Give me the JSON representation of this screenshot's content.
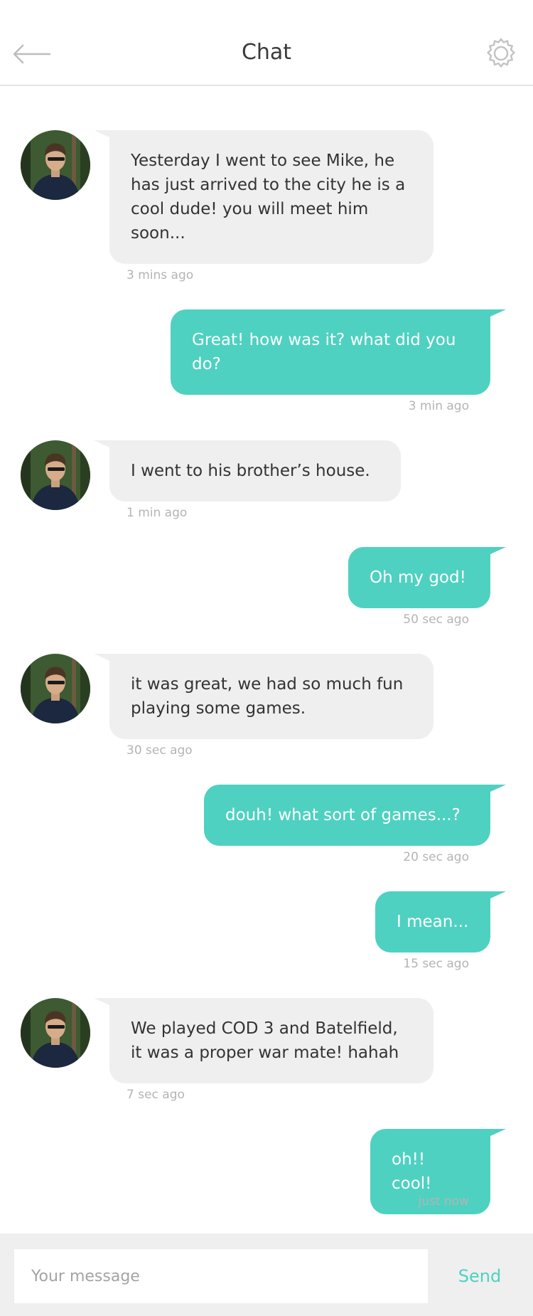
{
  "header": {
    "title": "Chat",
    "back_icon": "arrow-left-icon",
    "settings_icon": "gear-icon"
  },
  "colors": {
    "accent": "#4ed1c1",
    "incoming_bubble": "#efefef",
    "timestamp": "#b4b4b4"
  },
  "messages": [
    {
      "direction": "incoming",
      "text": "Yesterday I went to see Mike, he has just arrived to the city he is a cool dude! you will meet him soon...",
      "time": "3 mins ago"
    },
    {
      "direction": "outgoing",
      "text": "Great! how was it? what did you do?",
      "time": "3 min ago"
    },
    {
      "direction": "incoming",
      "text": "I went to his brother’s house.",
      "time": "1 min ago"
    },
    {
      "direction": "outgoing",
      "text": "Oh my god!",
      "time": "50 sec ago"
    },
    {
      "direction": "incoming",
      "text": "it was great, we had so much fun playing some games.",
      "time": "30 sec ago"
    },
    {
      "direction": "outgoing",
      "text": "douh! what sort of games...?",
      "time": "20 sec ago"
    },
    {
      "direction": "outgoing",
      "text": "I mean...",
      "time": "15 sec ago"
    },
    {
      "direction": "incoming",
      "text": "We played COD 3 and Batelfield, it was a proper war mate! hahah",
      "time": "7 sec ago"
    },
    {
      "direction": "outgoing",
      "text": "oh!! cool!",
      "time": "just now"
    }
  ],
  "composer": {
    "placeholder": "Your message",
    "send_label": "Send"
  }
}
